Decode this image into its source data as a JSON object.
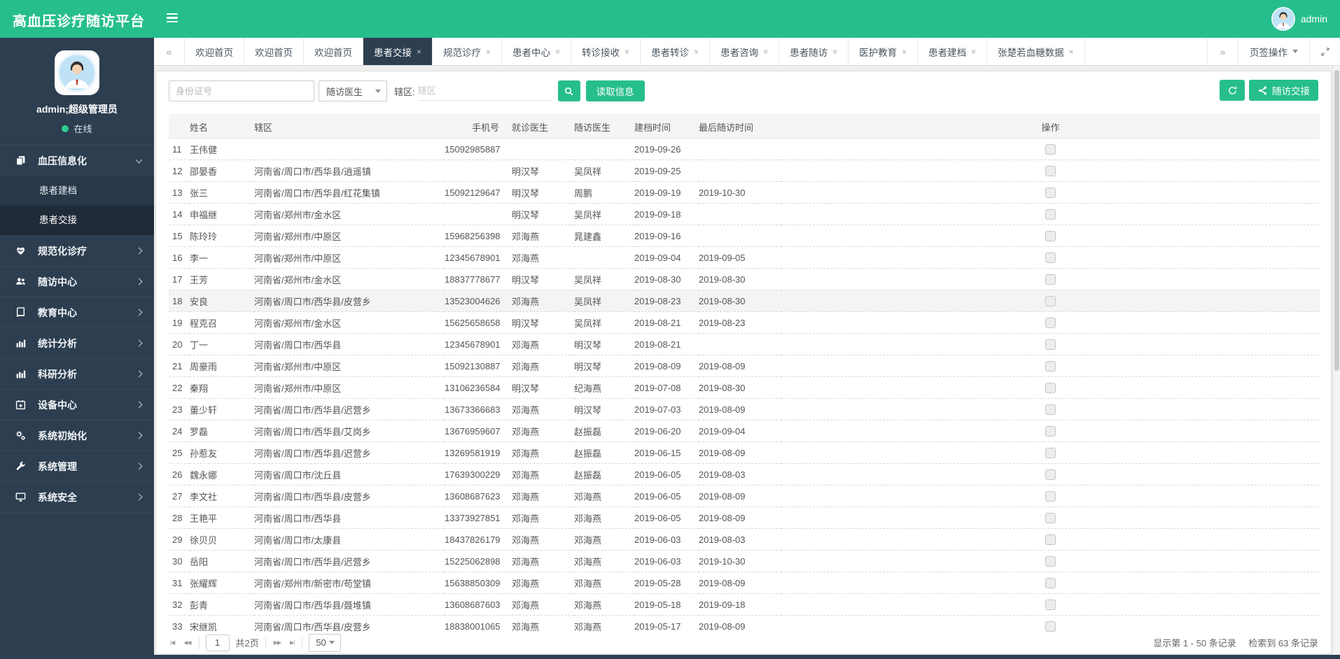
{
  "app": {
    "title": "高血压诊疗随访平台",
    "user": "admin"
  },
  "colors": {
    "accent_green": "#26be8d",
    "sidebar_navy": "#2d3e50",
    "online_dot": "#2ecc8f"
  },
  "sidebar": {
    "username": "admin;超级管理员",
    "status": "在线",
    "menu": [
      {
        "key": "bp-informatization",
        "label": "血压信息化",
        "icon": "copy-icon",
        "expanded": true,
        "children": [
          {
            "key": "patient-filing",
            "label": "患者建档",
            "active": false
          },
          {
            "key": "patient-handover",
            "label": "患者交接",
            "active": true
          }
        ]
      },
      {
        "key": "standardized-care",
        "label": "规范化诊疗",
        "icon": "heartbeat-icon"
      },
      {
        "key": "followup-center",
        "label": "随访中心",
        "icon": "users-icon"
      },
      {
        "key": "education-center",
        "label": "教育中心",
        "icon": "book-icon"
      },
      {
        "key": "statistical-analysis",
        "label": "统计分析",
        "icon": "bar-chart-icon"
      },
      {
        "key": "research-analysis",
        "label": "科研分析",
        "icon": "bar-chart-icon"
      },
      {
        "key": "device-center",
        "label": "设备中心",
        "icon": "calendar-plus-icon"
      },
      {
        "key": "system-init",
        "label": "系统初始化",
        "icon": "gears-icon"
      },
      {
        "key": "system-admin",
        "label": "系统管理",
        "icon": "wrench-icon"
      },
      {
        "key": "system-security",
        "label": "系统安全",
        "icon": "desktop-icon"
      }
    ]
  },
  "tabs": {
    "menu_label": "页签操作",
    "items": [
      {
        "key": "welcome-home-1",
        "label": "欢迎首页",
        "closable": false
      },
      {
        "key": "welcome-home-2",
        "label": "欢迎首页",
        "closable": false
      },
      {
        "key": "welcome-home-3",
        "label": "欢迎首页",
        "closable": false
      },
      {
        "key": "patient-handover",
        "label": "患者交接",
        "closable": true,
        "active": true
      },
      {
        "key": "standard-care",
        "label": "规范诊疗",
        "closable": true
      },
      {
        "key": "patient-center",
        "label": "患者中心",
        "closable": true
      },
      {
        "key": "referral-receive",
        "label": "转诊接收",
        "closable": true
      },
      {
        "key": "patient-referral",
        "label": "患者转诊",
        "closable": true
      },
      {
        "key": "patient-consult",
        "label": "患者咨询",
        "closable": true
      },
      {
        "key": "patient-followup",
        "label": "患者随访",
        "closable": true
      },
      {
        "key": "medical-education",
        "label": "医护教育",
        "closable": true
      },
      {
        "key": "patient-filing",
        "label": "患者建档",
        "closable": true
      },
      {
        "key": "zhang-churuo-glucose",
        "label": "张楚若血糖数据",
        "closable": true
      }
    ]
  },
  "toolbar": {
    "id_input_placeholder": "身份证号",
    "doctor_select_value": "随访医生",
    "district_label": "辖区:",
    "district_input_placeholder": "辖区",
    "read_info_button": "读取信息",
    "handover_button": "随访交接"
  },
  "table": {
    "columns": [
      "姓名",
      "辖区",
      "手机号",
      "就诊医生",
      "随访医生",
      "建档时间",
      "最后随访时间",
      "操作"
    ],
    "highlighted_index": "18",
    "rows": [
      [
        "11",
        "王伟健",
        "",
        "15092985887",
        "",
        "",
        "2019-09-26",
        ""
      ],
      [
        "12",
        "邵晏香",
        "河南省/周口市/西华县/逍遥镇",
        "",
        "明汉琴",
        "吴凤祥",
        "2019-09-25",
        ""
      ],
      [
        "13",
        "张三",
        "河南省/周口市/西华县/红花集镇",
        "15092129647",
        "明汉琴",
        "周鹏",
        "2019-09-19",
        "2019-10-30"
      ],
      [
        "14",
        "申福继",
        "河南省/郑州市/金水区",
        "",
        "明汉琴",
        "吴凤祥",
        "2019-09-18",
        ""
      ],
      [
        "15",
        "陈玲玲",
        "河南省/郑州市/中原区",
        "15968256398",
        "邓海燕",
        "晁建鑫",
        "2019-09-16",
        ""
      ],
      [
        "16",
        "李一",
        "河南省/郑州市/中原区",
        "12345678901",
        "邓海燕",
        "",
        "2019-09-04",
        "2019-09-05"
      ],
      [
        "17",
        "王芳",
        "河南省/郑州市/金水区",
        "18837778677",
        "明汉琴",
        "吴凤祥",
        "2019-08-30",
        "2019-08-30"
      ],
      [
        "18",
        "安良",
        "河南省/周口市/西华县/皮营乡",
        "13523004626",
        "邓海燕",
        "吴凤祥",
        "2019-08-23",
        "2019-08-30"
      ],
      [
        "19",
        "程克召",
        "河南省/郑州市/金水区",
        "15625658658",
        "明汉琴",
        "吴凤祥",
        "2019-08-21",
        "2019-08-23"
      ],
      [
        "20",
        "丁一",
        "河南省/周口市/西华县",
        "12345678901",
        "邓海燕",
        "明汉琴",
        "2019-08-21",
        ""
      ],
      [
        "21",
        "周豪雨",
        "河南省/郑州市/中原区",
        "15092130887",
        "邓海燕",
        "明汉琴",
        "2019-08-09",
        "2019-08-09"
      ],
      [
        "22",
        "秦翔",
        "河南省/郑州市/中原区",
        "13106236584",
        "明汉琴",
        "纪海燕",
        "2019-07-08",
        "2019-08-30"
      ],
      [
        "23",
        "董少轩",
        "河南省/周口市/西华县/迟营乡",
        "13673366683",
        "邓海燕",
        "明汉琴",
        "2019-07-03",
        "2019-08-09"
      ],
      [
        "24",
        "罗磊",
        "河南省/周口市/西华县/艾岗乡",
        "13676959607",
        "邓海燕",
        "赵振磊",
        "2019-06-20",
        "2019-09-04"
      ],
      [
        "25",
        "孙惹友",
        "河南省/周口市/西华县/迟营乡",
        "13269581919",
        "邓海燕",
        "赵振磊",
        "2019-06-15",
        "2019-08-09"
      ],
      [
        "26",
        "魏永娜",
        "河南省/周口市/沈丘县",
        "17639300229",
        "邓海燕",
        "赵振磊",
        "2019-06-05",
        "2019-08-03"
      ],
      [
        "27",
        "李文社",
        "河南省/周口市/西华县/皮营乡",
        "13608687623",
        "邓海燕",
        "邓海燕",
        "2019-06-05",
        "2019-08-09"
      ],
      [
        "28",
        "王艳平",
        "河南省/周口市/西华县",
        "13373927851",
        "邓海燕",
        "邓海燕",
        "2019-06-05",
        "2019-08-09"
      ],
      [
        "29",
        "徐贝贝",
        "河南省/周口市/太康县",
        "18437826179",
        "邓海燕",
        "邓海燕",
        "2019-06-03",
        "2019-08-03"
      ],
      [
        "30",
        "岳阳",
        "河南省/周口市/西华县/迟营乡",
        "15225062898",
        "邓海燕",
        "邓海燕",
        "2019-06-03",
        "2019-10-30"
      ],
      [
        "31",
        "张耀辉",
        "河南省/郑州市/新密市/苟堂镇",
        "15638850309",
        "邓海燕",
        "邓海燕",
        "2019-05-28",
        "2019-08-09"
      ],
      [
        "32",
        "彭青",
        "河南省/周口市/西华县/聂堆镇",
        "13608687603",
        "邓海燕",
        "邓海燕",
        "2019-05-18",
        "2019-09-18"
      ],
      [
        "33",
        "宋继凯",
        "河南省/周口市/西华县/皮营乡",
        "18838001065",
        "邓海燕",
        "邓海燕",
        "2019-05-17",
        "2019-08-09"
      ]
    ]
  },
  "pagination": {
    "page": "1",
    "total_pages_label": "共2页",
    "page_size": "50",
    "records_summary": "显示第 1 - 50 条记录",
    "search_summary": "检索到 63 条记录"
  }
}
